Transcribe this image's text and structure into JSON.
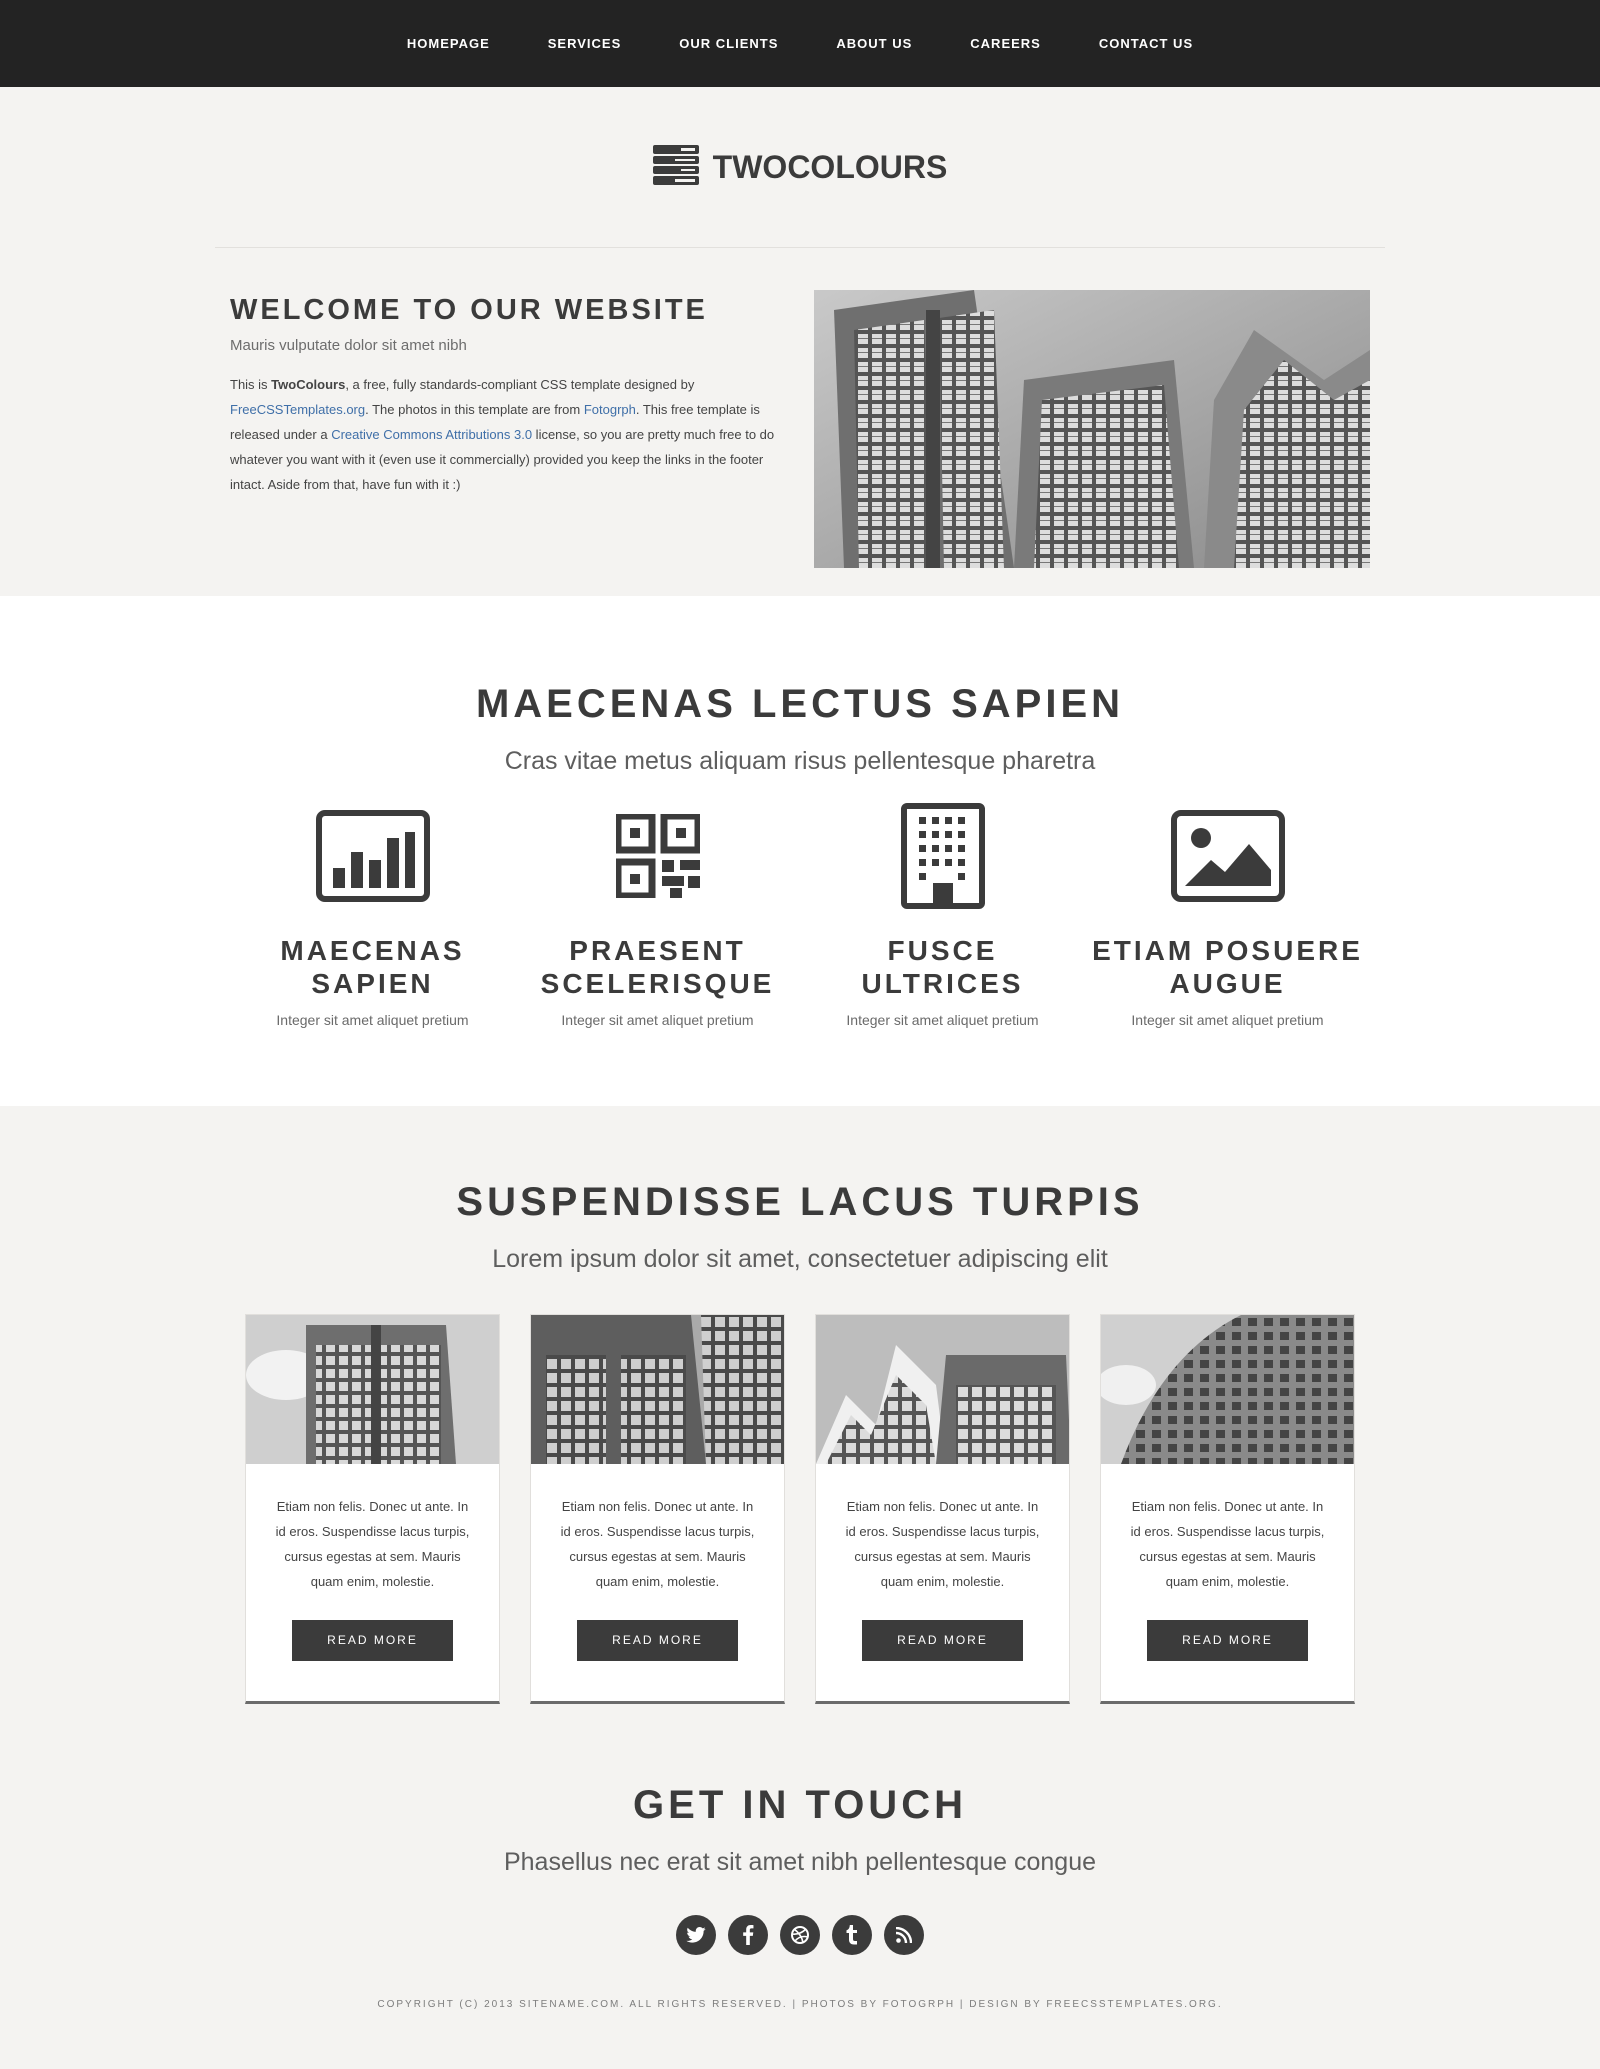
{
  "nav": {
    "items": [
      "Homepage",
      "Services",
      "Our Clients",
      "About Us",
      "Careers",
      "Contact Us"
    ]
  },
  "logo": {
    "text": "TWOCOLOURS",
    "icon": "menu-stack-icon"
  },
  "welcome": {
    "title": "WELCOME TO OUR WEBSITE",
    "subtitle": "Mauris vulputate dolor sit amet nibh",
    "p1": "This is ",
    "brand": "TwoColours",
    "p2": ", a free, fully standards-compliant CSS template designed by ",
    "link1": "FreeCSSTemplates.org",
    "p3": ". The photos in this template are from ",
    "link2": "Fotogrph",
    "p4": ". This free template is released under a ",
    "link3": "Creative Commons Attributions 3.0",
    "p5": " license, so you are pretty much free to do whatever you want with it (even use it commercially) provided you keep the links in the footer intact. Aside from that, have fun with it :)"
  },
  "features_section": {
    "title": "MAECENAS LECTUS SAPIEN",
    "subtitle": "Cras vitae metus aliquam risus pellentesque pharetra",
    "items": [
      {
        "icon": "bar-chart-icon",
        "title_line1": "MAECENAS",
        "title_line2": "SAPIEN",
        "text": "Integer sit amet aliquet pretium"
      },
      {
        "icon": "qr-code-icon",
        "title_line1": "PRAESENT",
        "title_line2": "SCELERISQUE",
        "text": "Integer sit amet aliquet pretium"
      },
      {
        "icon": "building-icon",
        "title_line1": "FUSCE",
        "title_line2": "ULTRICES",
        "text": "Integer sit amet aliquet pretium"
      },
      {
        "icon": "image-icon",
        "title_line1": "ETIAM POSUERE",
        "title_line2": "AUGUE",
        "text": "Integer sit amet aliquet pretium"
      }
    ]
  },
  "cards_section": {
    "title": "SUSPENDISSE LACUS TURPIS",
    "subtitle": "Lorem ipsum dolor sit amet, consectetuer adipiscing elit",
    "cards": [
      {
        "text": "Etiam non felis. Donec ut ante. In id eros. Suspendisse lacus turpis, cursus egestas at sem. Mauris quam enim, molestie.",
        "button": "READ MORE"
      },
      {
        "text": "Etiam non felis. Donec ut ante. In id eros. Suspendisse lacus turpis, cursus egestas at sem. Mauris quam enim, molestie.",
        "button": "READ MORE"
      },
      {
        "text": "Etiam non felis. Donec ut ante. In id eros. Suspendisse lacus turpis, cursus egestas at sem. Mauris quam enim, molestie.",
        "button": "READ MORE"
      },
      {
        "text": "Etiam non felis. Donec ut ante. In id eros. Suspendisse lacus turpis, cursus egestas at sem. Mauris quam enim, molestie.",
        "button": "READ MORE"
      }
    ]
  },
  "touch": {
    "title": "GET IN TOUCH",
    "subtitle": "Phasellus nec erat sit amet nibh pellentesque congue",
    "social": [
      "twitter-icon",
      "facebook-icon",
      "dribbble-icon",
      "tumblr-icon",
      "rss-icon"
    ]
  },
  "footer": {
    "copyright": "Copyright (c) 2013 Sitename.com. All rights reserved. | Photos by ",
    "photos_link": "Fotogrph",
    "mid": " | Design by ",
    "design_link": "FreeCSSTemplates.org",
    "end": "."
  },
  "colors": {
    "dark": "#232323",
    "text": "#3b3b3b",
    "link": "#3f6fa8",
    "bg": "#f4f3f1"
  }
}
